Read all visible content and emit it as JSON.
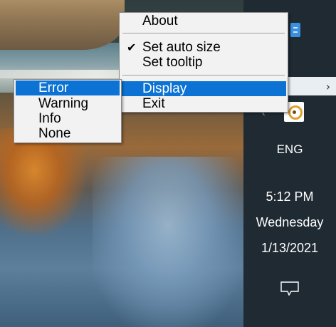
{
  "tray": {
    "language": "ENG",
    "clock": {
      "time": "5:12 PM",
      "day": "Wednesday",
      "date": "1/13/2021"
    },
    "flyout_chevron_icon": "chevron-right-icon",
    "back_icon": "back-arrow-icon",
    "icons": [
      "blue-app-icon",
      "tray-app-icon",
      "notification-icon"
    ]
  },
  "context_menu": {
    "items": [
      {
        "label": "About",
        "checked": false,
        "highlighted": false
      },
      {
        "label": "Set auto size",
        "checked": true,
        "highlighted": false
      },
      {
        "label": "Set tooltip",
        "checked": false,
        "highlighted": false
      },
      {
        "label": "Display",
        "checked": false,
        "highlighted": true
      },
      {
        "label": "Exit",
        "checked": false,
        "highlighted": false
      }
    ],
    "check_glyph": "✔"
  },
  "display_submenu": {
    "items": [
      {
        "label": "Error",
        "highlighted": true
      },
      {
        "label": "Warning",
        "highlighted": false
      },
      {
        "label": "Info",
        "highlighted": false
      },
      {
        "label": "None",
        "highlighted": false
      }
    ]
  },
  "colors": {
    "highlight": "#0c73d4",
    "taskbar": "#1f2a33",
    "menu_bg": "#f2f2f2"
  }
}
